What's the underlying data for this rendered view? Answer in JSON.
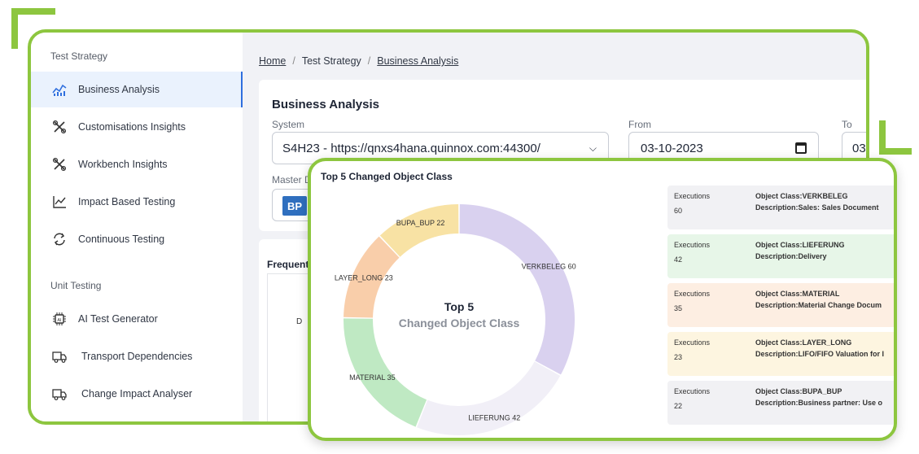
{
  "sidebar": {
    "sections": [
      {
        "title": "Test Strategy",
        "items": [
          {
            "label": "Business Analysis",
            "icon": "analytics-chart-icon",
            "active": true
          },
          {
            "label": "Customisations Insights",
            "icon": "tools-icon"
          },
          {
            "label": "Workbench Insights",
            "icon": "tools-icon"
          },
          {
            "label": "Impact Based Testing",
            "icon": "line-chart-icon"
          },
          {
            "label": "Continuous Testing",
            "icon": "refresh-icon"
          }
        ]
      },
      {
        "title": "Unit Testing",
        "items": [
          {
            "label": "AI Test Generator",
            "icon": "ai-chip-icon"
          },
          {
            "label": "Transport Dependencies",
            "icon": "truck-icon"
          },
          {
            "label": "Change Impact Analyser",
            "icon": "truck-icon"
          }
        ]
      }
    ]
  },
  "breadcrumb": {
    "home": "Home",
    "section": "Test Strategy",
    "page": "Business Analysis"
  },
  "business_analysis": {
    "title": "Business Analysis",
    "system_label": "System",
    "system_value": "S4H23 - https://qnxs4hana.quinnox.com:44300/",
    "from_label": "From",
    "from_value": "03-10-2023",
    "to_label": "To",
    "to_value": "03",
    "master_label": "Master D",
    "master_chip": "BP"
  },
  "frequent": {
    "title": "Frequent",
    "letter": "D"
  },
  "top5": {
    "title": "Top 5 Changed Object Class",
    "center_line1": "Top 5",
    "center_line2": "Changed Object Class",
    "executions_label": "Executions",
    "segments": [
      {
        "name": "VERKBELEG",
        "value": 60,
        "label": "VERKBELEG 60",
        "color": "#d9d1ef"
      },
      {
        "name": "LIEFERUNG",
        "value": 42,
        "label": "LIEFERUNG 42",
        "color": "#f1eff7"
      },
      {
        "name": "MATERIAL",
        "value": 35,
        "label": "MATERIAL 35",
        "color": "#bfe9c3"
      },
      {
        "name": "LAYER_LONG",
        "value": 23,
        "label": "LAYER_LONG 23",
        "color": "#f9ceaa"
      },
      {
        "name": "BUPA_BUP",
        "value": 22,
        "label": "BUPA_BUP 22",
        "color": "#f8e2a4"
      }
    ],
    "cards": [
      {
        "executions": "60",
        "object_class": "Object Class:VERKBELEG",
        "description": "Description:Sales: Sales Document",
        "bg": "#f1f1f4"
      },
      {
        "executions": "42",
        "object_class": "Object Class:LIEFERUNG",
        "description": "Description:Delivery",
        "bg": "#e7f6e8"
      },
      {
        "executions": "35",
        "object_class": "Object Class:MATERIAL",
        "description": "Description:Material Change Docum",
        "bg": "#fdeee2"
      },
      {
        "executions": "23",
        "object_class": "Object Class:LAYER_LONG",
        "description": "Description:LIFO/FIFO Valuation for I",
        "bg": "#fdf5e0"
      },
      {
        "executions": "22",
        "object_class": "Object Class:BUPA_BUP",
        "description": "Description:Business partner: Use o",
        "bg": "#f1f1f4"
      }
    ]
  }
}
